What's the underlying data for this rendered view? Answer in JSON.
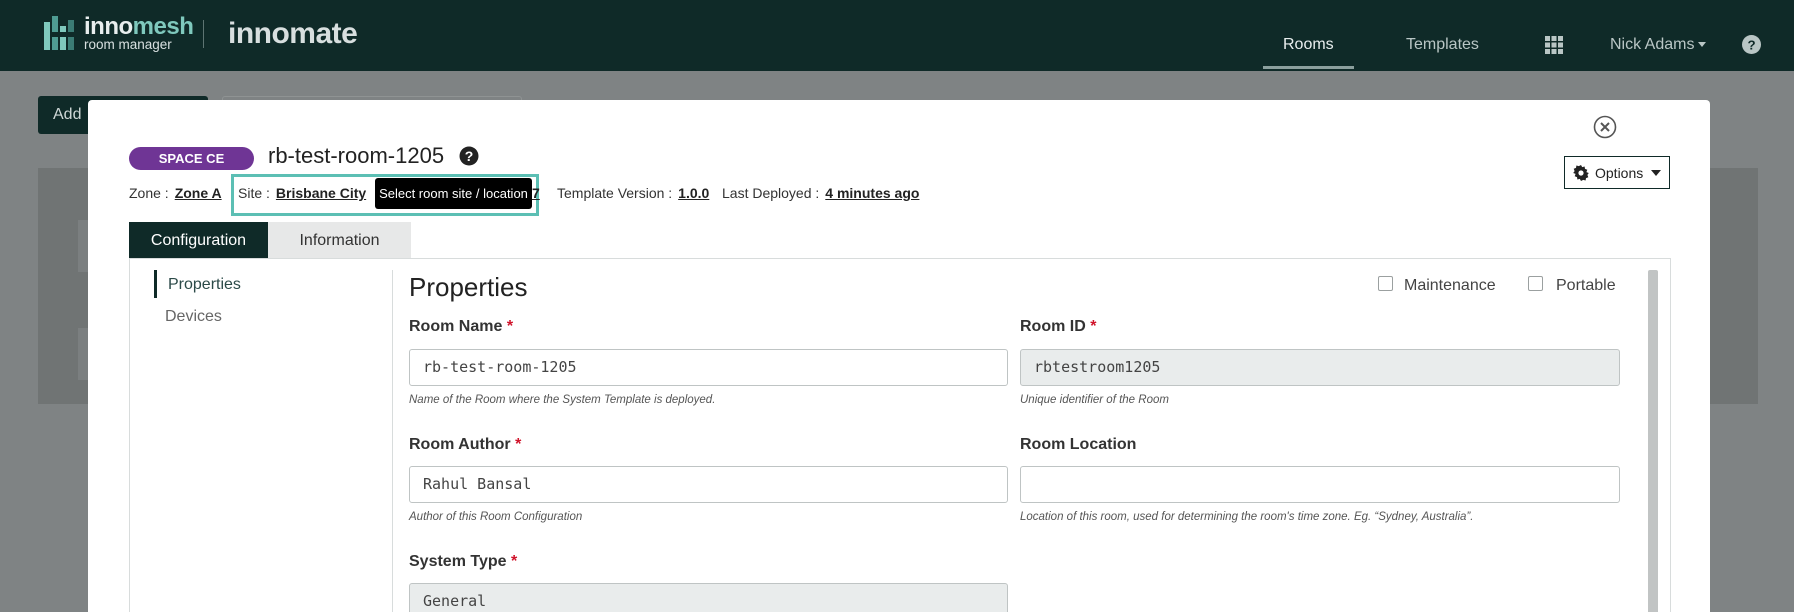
{
  "navbar": {
    "brand_prefix": "inno",
    "brand_suffix": "mesh",
    "brand_sub": "room manager",
    "product": "innomate",
    "links": [
      {
        "label": "Rooms",
        "active": true
      },
      {
        "label": "Templates",
        "active": false
      }
    ],
    "apps_icon": "grid-icon",
    "user": "Nick Adams",
    "help_icon": "question-circle-icon"
  },
  "background": {
    "add_button_label": "Add"
  },
  "modal": {
    "badge": "SPACE CE",
    "title": "rb-test-room-1205",
    "meta": {
      "zone_label": "Zone :",
      "zone_value": "Zone A",
      "site_label": "Site :",
      "site_value": "Brisbane City",
      "site_tooltip": "Select room site / location",
      "site_trail": "7",
      "template_version_label": "Template Version :",
      "template_version_value": "1.0.0",
      "last_deployed_label": "Last Deployed :",
      "last_deployed_value": "4 minutes ago"
    },
    "options_label": "Options",
    "tabs": [
      {
        "label": "Configuration",
        "active": true
      },
      {
        "label": "Information",
        "active": false
      }
    ],
    "sidebar": [
      {
        "label": "Properties",
        "active": true
      },
      {
        "label": "Devices",
        "active": false
      }
    ],
    "section_title": "Properties",
    "checkboxes": [
      {
        "label": "Maintenance",
        "checked": false
      },
      {
        "label": "Portable",
        "checked": false
      }
    ],
    "fields": {
      "room_name": {
        "label": "Room Name",
        "value": "rb-test-room-1205",
        "help": "Name of the Room where the System Template is deployed."
      },
      "room_id": {
        "label": "Room ID",
        "value": "rbtestroom1205",
        "help": "Unique identifier of the Room"
      },
      "room_author": {
        "label": "Room Author",
        "value": "Rahul Bansal",
        "help": "Author of this Room Configuration"
      },
      "room_location": {
        "label": "Room Location",
        "value": "",
        "help": "Location of this room, used for determining the room's time zone. Eg. “Sydney, Australia”."
      },
      "system_type": {
        "label": "System Type",
        "value": "General"
      }
    },
    "required_marker": "*"
  },
  "colors": {
    "navbar_bg": "#0f2a28",
    "badge": "#6f3595",
    "highlight": "#5cbfb4",
    "required": "#d0132a"
  }
}
